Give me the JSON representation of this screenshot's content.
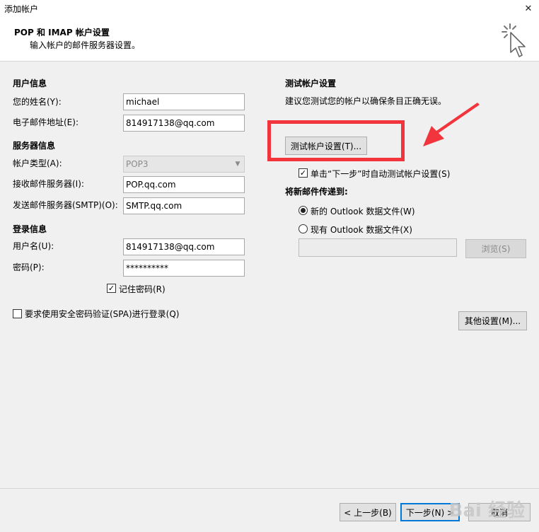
{
  "window": {
    "title": "添加帐户",
    "close_glyph": "✕"
  },
  "header": {
    "title": "POP 和 IMAP 帐户设置",
    "subtitle": "输入帐户的邮件服务器设置。"
  },
  "user_info": {
    "section": "用户信息",
    "name_label": "您的姓名(Y):",
    "name_value": "michael",
    "email_label": "电子邮件地址(E):",
    "email_value": "814917138@qq.com"
  },
  "server_info": {
    "section": "服务器信息",
    "account_type_label": "帐户类型(A):",
    "account_type_value": "POP3",
    "incoming_label": "接收邮件服务器(I):",
    "incoming_value": "POP.qq.com",
    "outgoing_label": "发送邮件服务器(SMTP)(O):",
    "outgoing_value": "SMTP.qq.com"
  },
  "login_info": {
    "section": "登录信息",
    "username_label": "用户名(U):",
    "username_value": "814917138@qq.com",
    "password_label": "密码(P):",
    "password_value": "**********",
    "remember_label": "记住密码(R)",
    "remember_checked": true,
    "spa_label": "要求使用安全密码验证(SPA)进行登录(Q)",
    "spa_checked": false
  },
  "test_settings": {
    "section": "测试帐户设置",
    "description": "建议您测试您的帐户以确保条目正确无误。",
    "test_button": "测试帐户设置(T)...",
    "auto_test_label": "单击“下一步”时自动测试帐户设置(S)",
    "auto_test_checked": true
  },
  "deliver": {
    "section": "将新邮件传递到:",
    "new_file_label": "新的 Outlook 数据文件(W)",
    "existing_file_label": "现有 Outlook 数据文件(X)",
    "selected": "new",
    "browse_button": "浏览(S)"
  },
  "more_settings_button": "其他设置(M)...",
  "footer": {
    "back_button": "< 上一步(B)",
    "next_button": "下一步(N) >",
    "cancel_button": "取消"
  },
  "colors": {
    "highlight": "#f2353c",
    "arrow": "#f2353c"
  },
  "icons": {
    "close": "close-icon",
    "header": "click-cursor-icon",
    "check": "checkmark-icon"
  },
  "watermark": "Bai 经验"
}
